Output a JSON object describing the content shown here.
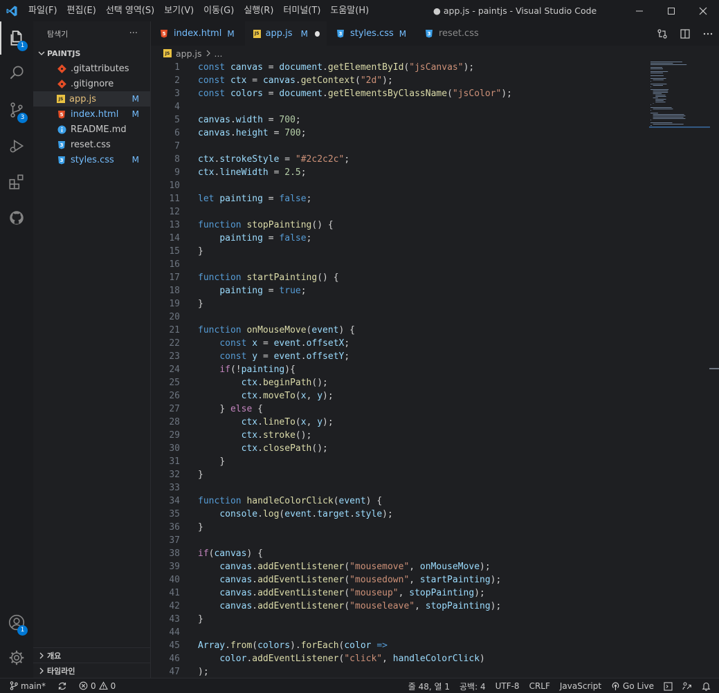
{
  "titlebar": {
    "menu": [
      "파일(F)",
      "편집(E)",
      "선택 영역(S)",
      "보기(V)",
      "이동(G)",
      "실행(R)",
      "터미널(T)",
      "도움말(H)"
    ],
    "title": "● app.js - paintjs - Visual Studio Code"
  },
  "activitybar": {
    "explorer_badge": "1",
    "scm_badge": "3",
    "accounts_badge": "1"
  },
  "sidebar": {
    "header": "탐색기",
    "more": "···",
    "folder": "PAINTJS",
    "files": [
      {
        "name": ".gitattributes",
        "icon": "git-icon",
        "mod": ""
      },
      {
        "name": ".gitignore",
        "icon": "git-icon",
        "mod": ""
      },
      {
        "name": "app.js",
        "icon": "js-icon",
        "mod": "M"
      },
      {
        "name": "index.html",
        "icon": "html-icon",
        "mod": "M"
      },
      {
        "name": "README.md",
        "icon": "info-icon",
        "mod": ""
      },
      {
        "name": "reset.css",
        "icon": "css-icon",
        "mod": ""
      },
      {
        "name": "styles.css",
        "icon": "css-icon",
        "mod": "M"
      }
    ],
    "outline": "개요",
    "timeline": "타임라인"
  },
  "tabs": [
    {
      "name": "index.html",
      "mod": "M"
    },
    {
      "name": "app.js",
      "mod": "M"
    },
    {
      "name": "styles.css",
      "mod": "M"
    },
    {
      "name": "reset.css",
      "mod": ""
    }
  ],
  "breadcrumb": {
    "file": "app.js",
    "more": "..."
  },
  "code_lines": [
    "const canvas = document.getElementById(\"jsCanvas\");",
    "const ctx = canvas.getContext(\"2d\");",
    "const colors = document.getElementsByClassName(\"jsColor\");",
    "",
    "canvas.width = 700;",
    "canvas.height = 700;",
    "",
    "ctx.strokeStyle = \"#2c2c2c\";",
    "ctx.lineWidth = 2.5;",
    "",
    "let painting = false;",
    "",
    "function stopPainting() {",
    "    painting = false;",
    "}",
    "",
    "function startPainting() {",
    "    painting = true;",
    "}",
    "",
    "function onMouseMove(event) {",
    "    const x = event.offsetX;",
    "    const y = event.offsetY;",
    "    if(!painting){",
    "        ctx.beginPath();",
    "        ctx.moveTo(x, y);",
    "    } else {",
    "        ctx.lineTo(x, y);",
    "        ctx.stroke();",
    "        ctx.closePath();",
    "    }",
    "}",
    "",
    "function handleColorClick(event) {",
    "    console.log(event.target.style);",
    "}",
    "",
    "if(canvas) {",
    "    canvas.addEventListener(\"mousemove\", onMouseMove);",
    "    canvas.addEventListener(\"mousedown\", startPainting);",
    "    canvas.addEventListener(\"mouseup\", stopPainting);",
    "    canvas.addEventListener(\"mouseleave\", stopPainting);",
    "}",
    "",
    "Array.from(colors).forEach(color =>",
    "    color.addEventListener(\"click\", handleColorClick)",
    ");"
  ],
  "statusbar": {
    "branch": "main*",
    "errors": "0",
    "warnings": "0",
    "cursor": "줄 48, 열 1",
    "spaces": "공백: 4",
    "encoding": "UTF-8",
    "eol": "CRLF",
    "language": "JavaScript",
    "golive": "Go Live"
  },
  "colors": {
    "accent": "#0078d4",
    "modified": "#75beff"
  }
}
